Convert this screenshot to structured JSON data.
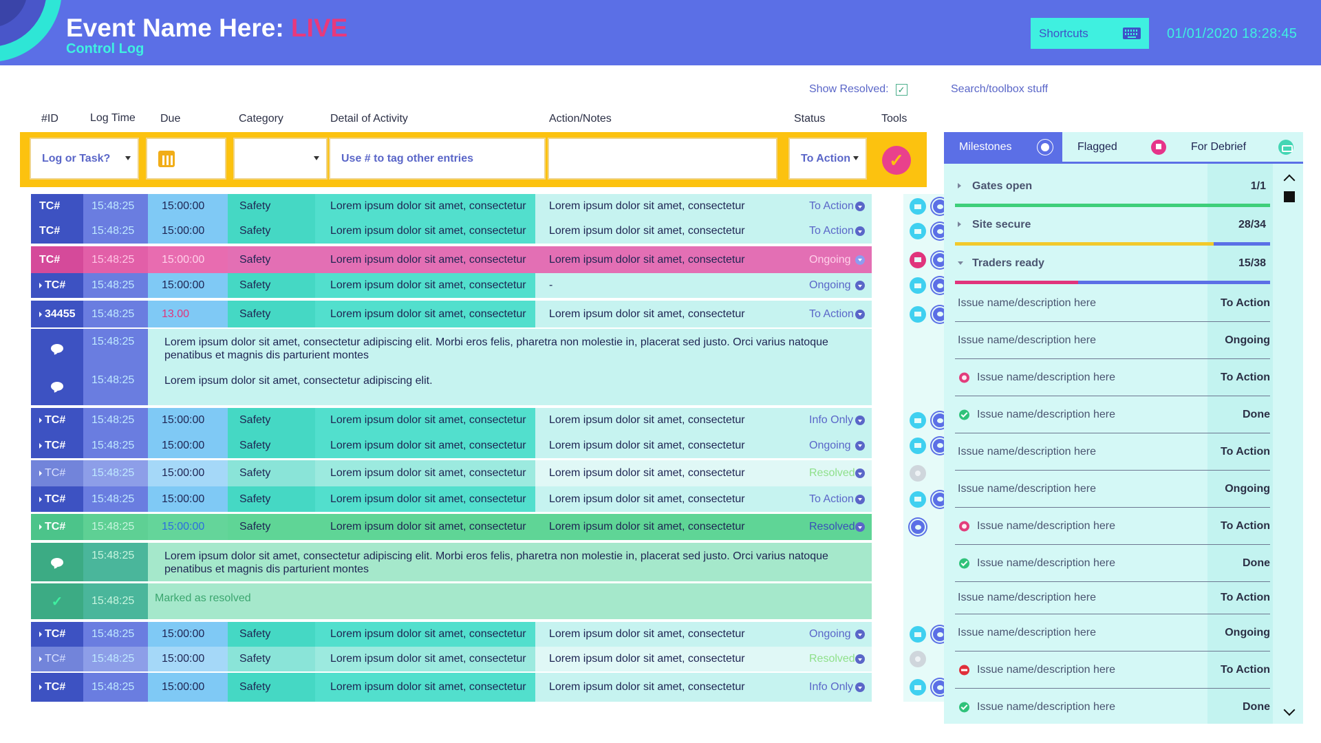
{
  "header": {
    "title": "Event Name Here:",
    "live": "LIVE",
    "subtitle": "Control Log",
    "shortcuts_label": "Shortcuts",
    "datetime": "01/01/2020 18:28:45"
  },
  "controls": {
    "show_resolved": "Show Resolved:",
    "toolbox": "Search/toolbox stuff"
  },
  "columns": [
    "#ID",
    "Log Time",
    "Due",
    "Category",
    "Detail of Activity",
    "Action/Notes",
    "Status",
    "Tools"
  ],
  "entry": {
    "type": "Log or Task?",
    "detail_placeholder": "Use # to tag other entries",
    "status": "To Action"
  },
  "rows": [
    {
      "kind": "entry",
      "style": "normal",
      "id": "TC#",
      "time": "15:48:25",
      "due": "15:00:00",
      "category": "Safety",
      "detail": "Lorem ipsum dolor sit amet, consectetur",
      "notes": "Lorem ipsum dolor sit amet, consectetur",
      "status": "To Action",
      "tools": [
        "flag",
        "chat"
      ]
    },
    {
      "kind": "entry",
      "style": "normal",
      "id": "TC#",
      "time": "15:48:25",
      "due": "15:00:00",
      "category": "Safety",
      "detail": "Lorem ipsum dolor sit amet, consectetur",
      "notes": "Lorem ipsum dolor sit amet, consectetur",
      "status": "To Action",
      "tools": [
        "flag",
        "chat"
      ]
    },
    {
      "kind": "entry",
      "style": "pink",
      "id": "TC#",
      "time": "15:48:25",
      "due": "15:00:00",
      "category": "Safety",
      "detail": "Lorem ipsum dolor sit amet, consectetur",
      "notes": "Lorem ipsum dolor sit amet, consectetur",
      "status": "Ongoing",
      "tools": [
        "flag-red",
        "chat"
      ]
    },
    {
      "kind": "entry",
      "style": "normal",
      "caret": true,
      "id": "TC#",
      "time": "15:48:25",
      "due": "15:00:00",
      "category": "Safety",
      "detail": "Lorem ipsum dolor sit amet, consectetur",
      "notes": "-",
      "status": "Ongoing",
      "tools": [
        "flag",
        "chat"
      ]
    },
    {
      "kind": "entry",
      "style": "normal",
      "caret": true,
      "id": "34455",
      "time": "15:48:25",
      "due": "13.00",
      "due_color": "#e0347c",
      "category": "Safety",
      "detail": "Lorem ipsum dolor sit amet, consectetur",
      "notes": "Lorem ipsum dolor sit amet, consectetur",
      "status": "To Action",
      "tools": [
        "flag",
        "chat"
      ]
    },
    {
      "kind": "comment",
      "style": "normal",
      "time": "15:48:25",
      "text": "Lorem ipsum dolor sit amet, consectetur adipiscing elit. Morbi eros felis, pharetra non molestie in, placerat sed justo. Orci varius natoque penatibus et magnis dis parturient montes"
    },
    {
      "kind": "comment",
      "style": "normal",
      "time": "15:48:25",
      "text": "Lorem ipsum dolor sit amet, consectetur adipiscing elit."
    },
    {
      "kind": "entry",
      "style": "normal",
      "caret": true,
      "id": "TC#",
      "time": "15:48:25",
      "due": "15:00:00",
      "category": "Safety",
      "detail": "Lorem ipsum dolor sit amet, consectetur",
      "notes": "Lorem ipsum dolor sit amet, consectetur",
      "status": "Info Only",
      "tools": [
        "flag",
        "chat"
      ]
    },
    {
      "kind": "entry",
      "style": "normal",
      "caret": true,
      "id": "TC#",
      "time": "15:48:25",
      "due": "15:00:00",
      "category": "Safety",
      "detail": "Lorem ipsum dolor sit amet, consectetur",
      "notes": "Lorem ipsum dolor sit amet, consectetur",
      "status": "Ongoing",
      "tools": [
        "flag",
        "chat"
      ]
    },
    {
      "kind": "entry",
      "style": "faded",
      "caret": true,
      "id": "TC#",
      "time": "15:48:25",
      "due": "15:00:00",
      "category": "Safety",
      "detail": "Lorem ipsum dolor sit amet, consectetur",
      "notes": "Lorem ipsum dolor sit amet, consectetur",
      "status": "Resolved",
      "tools": [
        "grey"
      ]
    },
    {
      "kind": "entry",
      "style": "normal",
      "caret": true,
      "id": "TC#",
      "time": "15:48:25",
      "due": "15:00:00",
      "category": "Safety",
      "detail": "Lorem ipsum dolor sit amet, consectetur",
      "notes": "Lorem ipsum dolor sit amet, consectetur",
      "status": "To Action",
      "tools": [
        "flag",
        "chat"
      ]
    },
    {
      "kind": "entry",
      "style": "green",
      "caret": true,
      "id": "TC#",
      "time": "15:48:25",
      "due": "15:00:00",
      "category": "Safety",
      "detail": "Lorem ipsum dolor sit amet, consectetur",
      "notes": "Lorem ipsum dolor sit amet, consectetur",
      "status": "Resolved",
      "tools": [
        "chat"
      ]
    },
    {
      "kind": "comment",
      "style": "green",
      "time": "15:48:25",
      "text": "Lorem ipsum dolor sit amet, consectetur adipiscing elit. Morbi eros felis, pharetra non molestie in, placerat sed justo. Orci varius natoque penatibus et magnis dis parturient montes"
    },
    {
      "kind": "comment",
      "style": "resolved",
      "time": "15:48:25",
      "text": "Marked as resolved"
    },
    {
      "kind": "entry",
      "style": "normal",
      "caret": true,
      "id": "TC#",
      "time": "15:48:25",
      "due": "15:00:00",
      "category": "Safety",
      "detail": "Lorem ipsum dolor sit amet, consectetur",
      "notes": "Lorem ipsum dolor sit amet, consectetur",
      "status": "Ongoing",
      "tools": [
        "flag",
        "chat"
      ]
    },
    {
      "kind": "entry",
      "style": "faded",
      "caret": true,
      "id": "TC#",
      "time": "15:48:25",
      "due": "15:00:00",
      "category": "Safety",
      "detail": "Lorem ipsum dolor sit amet, consectetur",
      "notes": "Lorem ipsum dolor sit amet, consectetur",
      "status": "Resolved",
      "tools": [
        "grey"
      ]
    },
    {
      "kind": "entry",
      "style": "normal",
      "caret": true,
      "id": "TC#",
      "time": "15:48:25",
      "due": "15:00:00",
      "category": "Safety",
      "detail": "Lorem ipsum dolor sit amet, consectetur",
      "notes": "Lorem ipsum dolor sit amet, consectetur",
      "status": "Info Only",
      "tools": [
        "flag",
        "chat"
      ]
    }
  ],
  "panel": {
    "tabs": [
      "Milestones",
      "Flagged",
      "For Debrief"
    ],
    "milestones": [
      {
        "name": "Gates open",
        "count": "1/1",
        "open": false,
        "progress": 1.0,
        "colors": [
          "#3ecf7a"
        ]
      },
      {
        "name": "Site secure",
        "count": "28/34",
        "open": false,
        "progress": 0.82,
        "colors": [
          "#f2c92c",
          "#5b6fe6"
        ]
      },
      {
        "name": "Traders ready",
        "count": "15/38",
        "open": true,
        "progress": 0.39,
        "colors": [
          "#e0347c",
          "#5b6fe6"
        ]
      }
    ],
    "issues": [
      {
        "name": "Issue name/description here",
        "status": "To Action",
        "icon": ""
      },
      {
        "name": "Issue name/description here",
        "status": "Ongoing",
        "icon": ""
      },
      {
        "name": "Issue name/description here",
        "status": "To Action",
        "icon": "alert"
      },
      {
        "name": "Issue name/description here",
        "status": "Done",
        "icon": "done"
      },
      {
        "name": "Issue name/description here",
        "status": "To Action",
        "icon": ""
      },
      {
        "name": "Issue name/description here",
        "status": "Ongoing",
        "icon": ""
      },
      {
        "name": "Issue name/description here",
        "status": "To Action",
        "icon": "alert"
      },
      {
        "name": "Issue name/description here",
        "status": "Done",
        "icon": "done"
      },
      {
        "name": "Issue name/description here",
        "status": "To Action",
        "icon": ""
      },
      {
        "name": "Issue name/description here",
        "status": "Ongoing",
        "icon": ""
      },
      {
        "name": "Issue name/description here",
        "status": "To Action",
        "icon": "stop"
      },
      {
        "name": "Issue name/description here",
        "status": "Done",
        "icon": "done"
      }
    ]
  }
}
